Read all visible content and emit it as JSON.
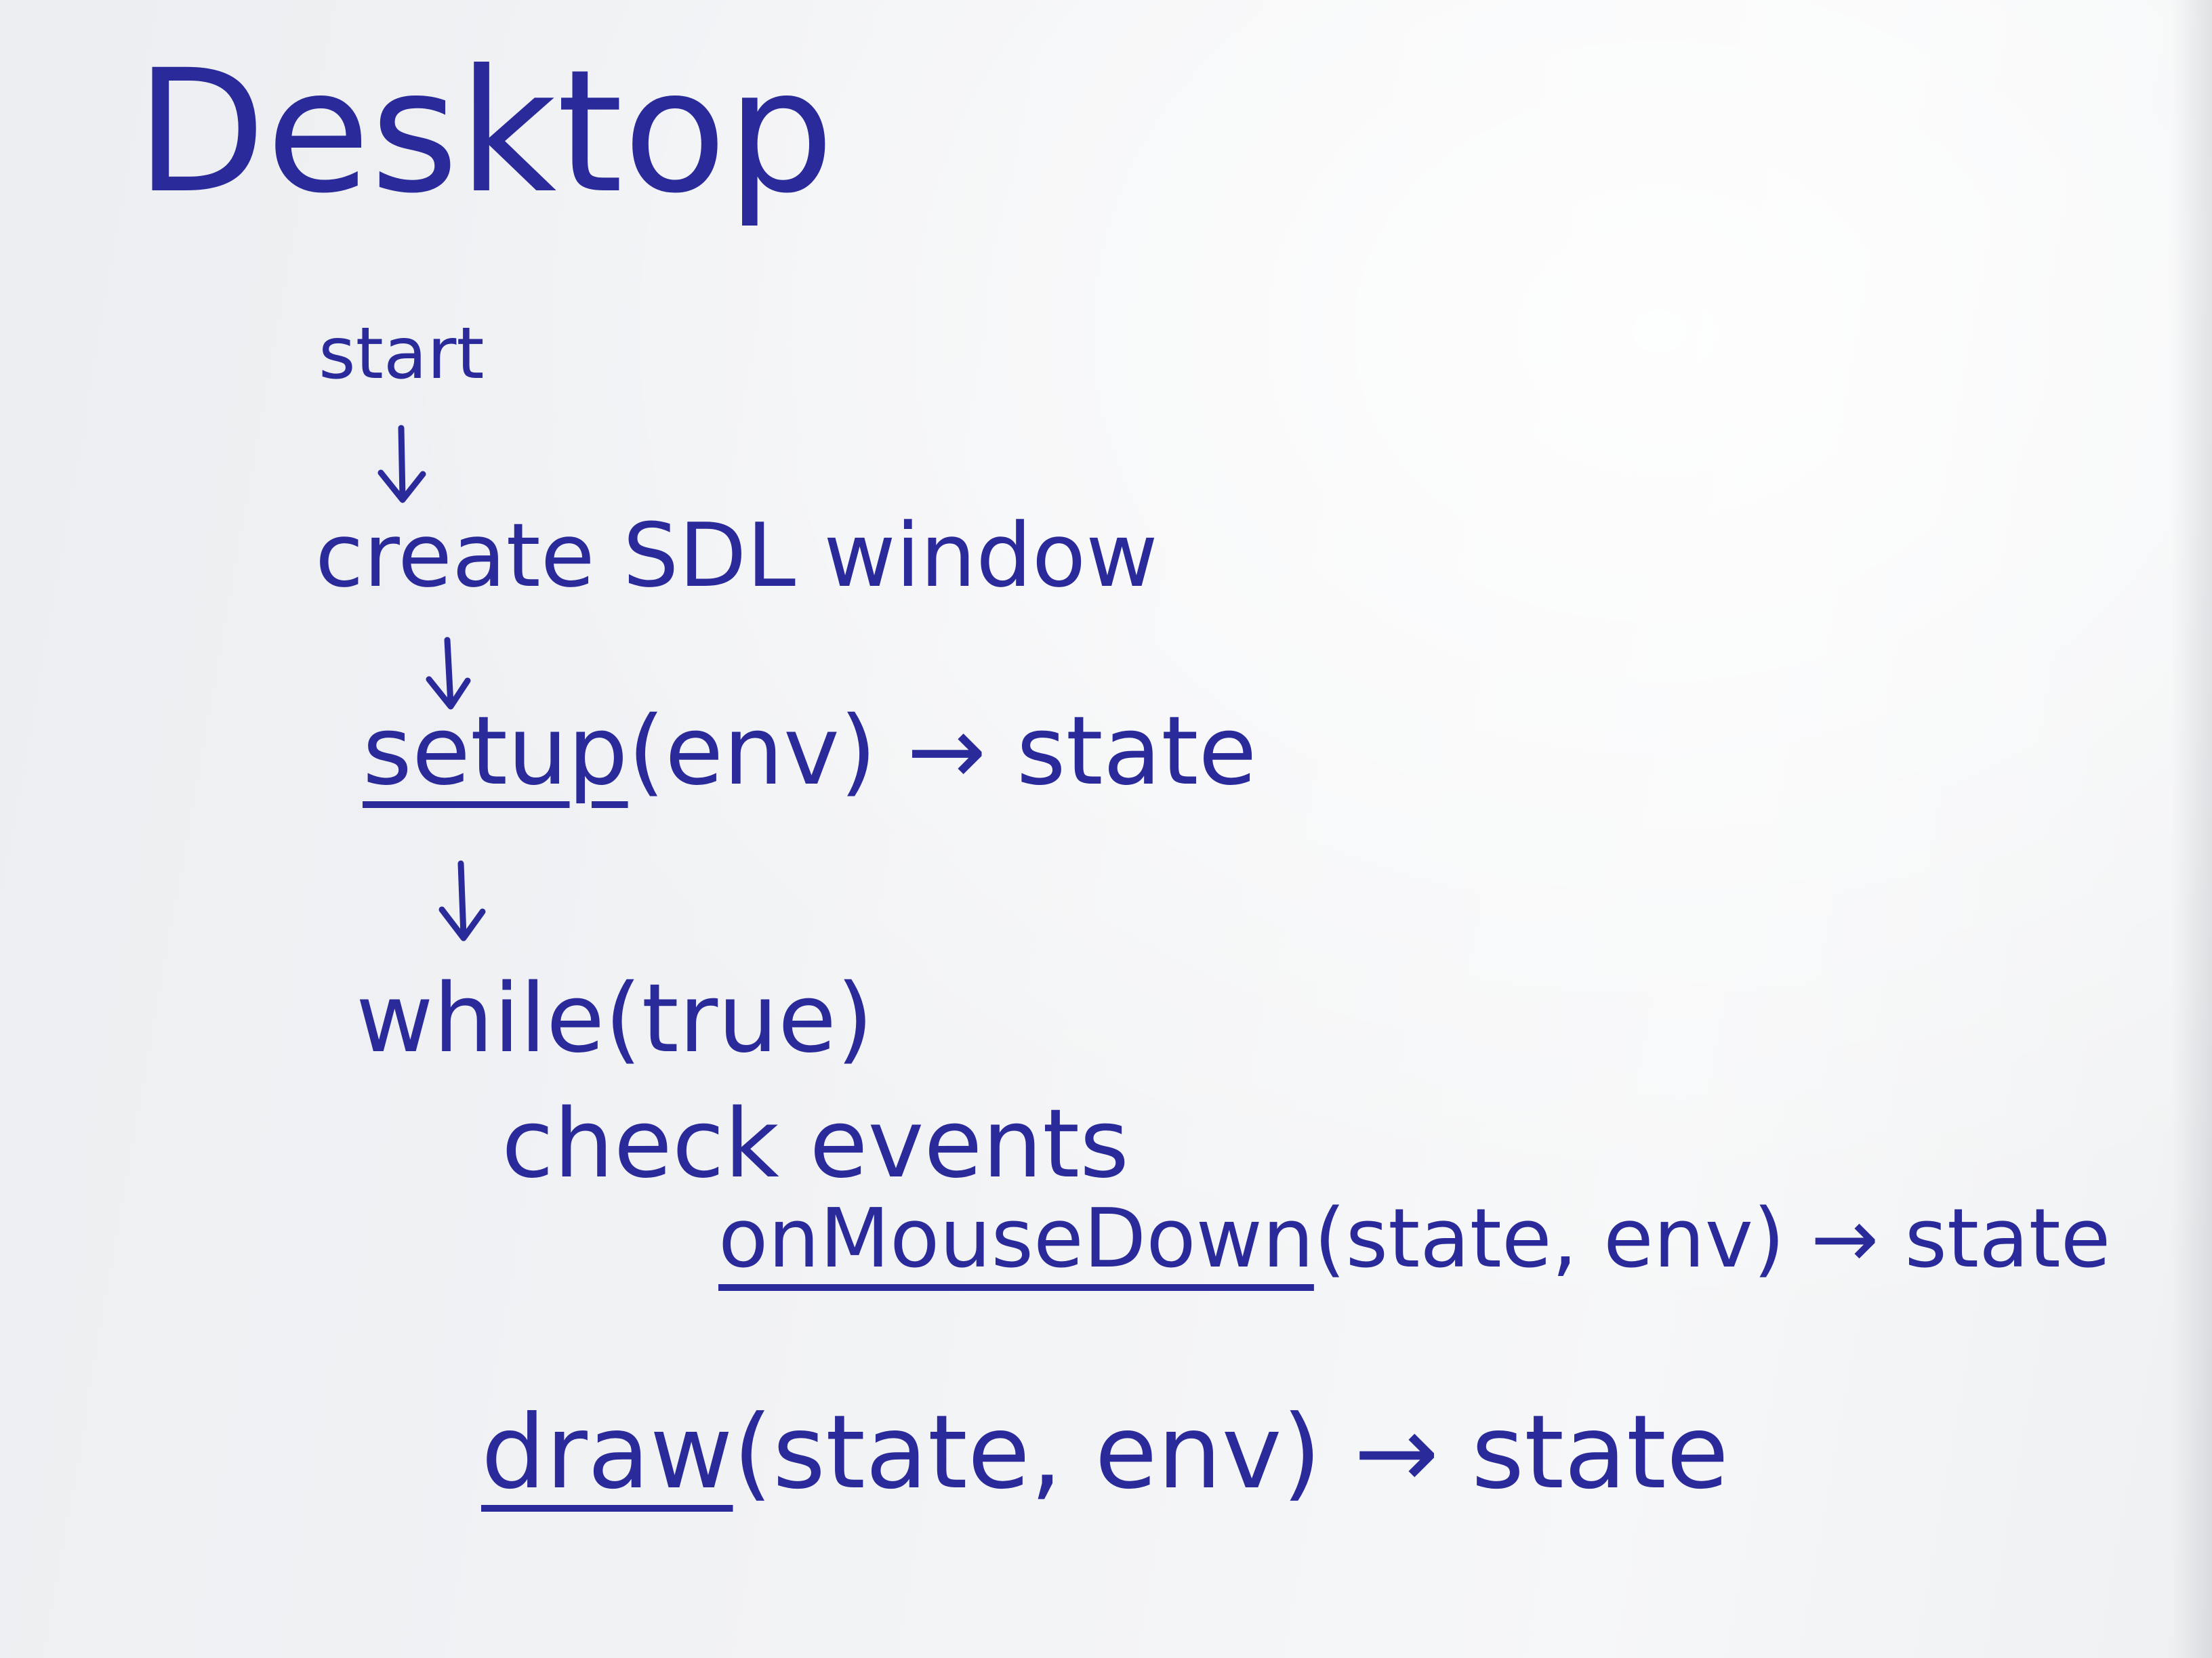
{
  "title": "Desktop",
  "steps": {
    "start": "start",
    "create_window": "create SDL window",
    "setup": {
      "fn": "setup",
      "rest": "(env) → state"
    },
    "loop": "while(true)",
    "check": "check events",
    "mouse": {
      "fn": "onMouseDown",
      "rest": "(state, env) → state"
    },
    "draw": {
      "fn": "draw",
      "rest": "(state, env) → state"
    }
  },
  "colors": {
    "ink": "#2a2a9a",
    "paper": "#f1f2f4"
  },
  "icons": [
    "down-arrow-icon"
  ]
}
